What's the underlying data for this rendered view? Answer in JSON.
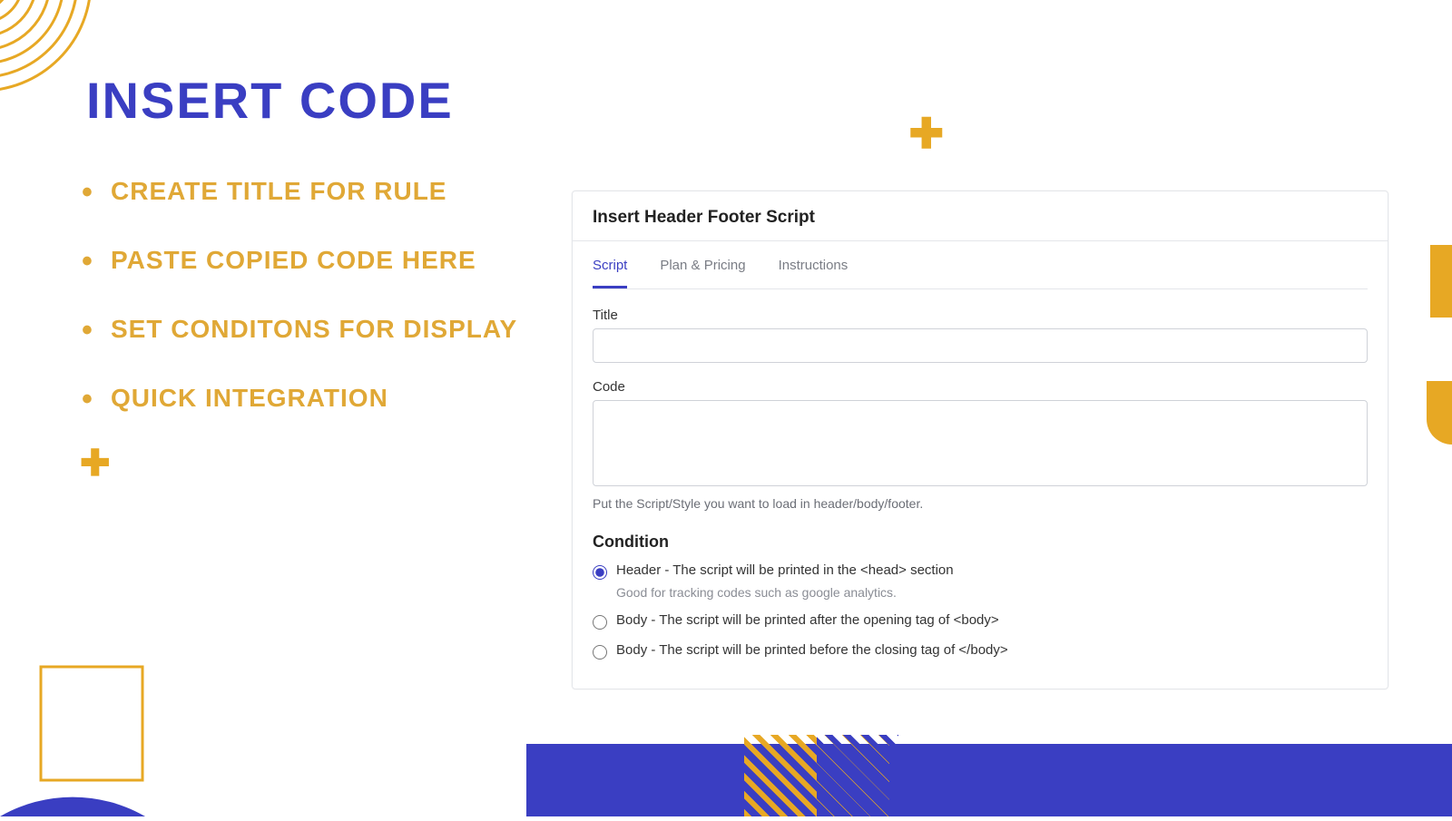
{
  "colors": {
    "accent_blue": "#3a3ec2",
    "accent_gold": "#e7a824"
  },
  "page": {
    "title": "INSERT CODE"
  },
  "bullets": [
    "CREATE TITLE FOR RULE",
    "PASTE COPIED CODE HERE",
    "SET CONDITONS FOR DISPLAY",
    "QUICK INTEGRATION"
  ],
  "form": {
    "header": "Insert Header Footer Script",
    "tabs": [
      {
        "label": "Script",
        "active": true
      },
      {
        "label": "Plan & Pricing",
        "active": false
      },
      {
        "label": "Instructions",
        "active": false
      }
    ],
    "title_field": {
      "label": "Title",
      "value": ""
    },
    "code_field": {
      "label": "Code",
      "value": "",
      "helper": "Put the Script/Style you want to load in header/body/footer."
    },
    "condition": {
      "heading": "Condition",
      "options": [
        {
          "label": "Header - The script will be printed in the <head> section",
          "sub": "Good for tracking codes such as google analytics.",
          "checked": true
        },
        {
          "label": "Body - The script will be printed after the opening tag of <body>",
          "sub": "",
          "checked": false
        },
        {
          "label": "Body - The script will be printed before the closing tag of </body>",
          "sub": "",
          "checked": false
        }
      ]
    }
  }
}
